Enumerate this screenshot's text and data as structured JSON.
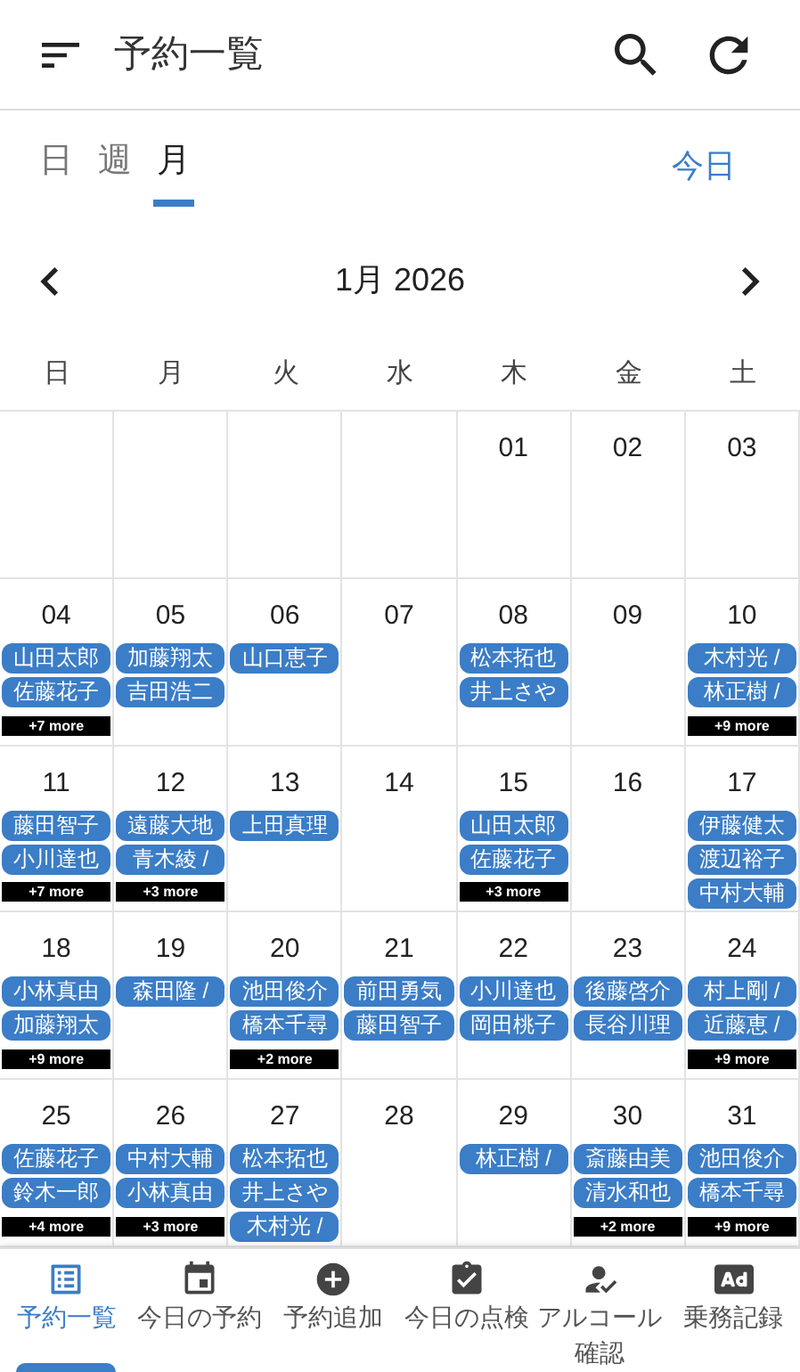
{
  "header": {
    "title": "予約一覧"
  },
  "view_tabs": [
    {
      "label": "日",
      "selected": false
    },
    {
      "label": "週",
      "selected": false
    },
    {
      "label": "月",
      "selected": true
    }
  ],
  "today_button": "今日",
  "month_label": "1月 2026",
  "weekdays": [
    "日",
    "月",
    "火",
    "水",
    "木",
    "金",
    "土"
  ],
  "cells": [
    {
      "kind": "empty"
    },
    {
      "kind": "empty"
    },
    {
      "kind": "empty"
    },
    {
      "kind": "empty"
    },
    {
      "kind": "day",
      "date": "01"
    },
    {
      "kind": "day",
      "date": "02"
    },
    {
      "kind": "day",
      "date": "03"
    },
    {
      "kind": "day",
      "date": "04",
      "events": [
        "山田太郎",
        "佐藤花子"
      ],
      "more": "+7 more"
    },
    {
      "kind": "day",
      "date": "05",
      "events": [
        "加藤翔太",
        "吉田浩二"
      ]
    },
    {
      "kind": "day",
      "date": "06",
      "events": [
        "山口恵子"
      ]
    },
    {
      "kind": "day",
      "date": "07"
    },
    {
      "kind": "day",
      "date": "08",
      "events": [
        "松本拓也",
        "井上さや"
      ]
    },
    {
      "kind": "day",
      "date": "09"
    },
    {
      "kind": "day",
      "date": "10",
      "events": [
        "木村光 /",
        "林正樹 /"
      ],
      "more": "+9 more"
    },
    {
      "kind": "day",
      "date": "11",
      "events": [
        "藤田智子",
        "小川達也"
      ],
      "more": "+7 more"
    },
    {
      "kind": "day",
      "date": "12",
      "events": [
        "遠藤大地",
        "青木綾 /"
      ],
      "more": "+3 more"
    },
    {
      "kind": "day",
      "date": "13",
      "events": [
        "上田真理"
      ]
    },
    {
      "kind": "day",
      "date": "14"
    },
    {
      "kind": "day",
      "date": "15",
      "events": [
        "山田太郎",
        "佐藤花子"
      ],
      "more": "+3 more"
    },
    {
      "kind": "day",
      "date": "16"
    },
    {
      "kind": "day",
      "date": "17",
      "events": [
        "伊藤健太",
        "渡辺裕子",
        "中村大輔"
      ]
    },
    {
      "kind": "day",
      "date": "18",
      "events": [
        "小林真由",
        "加藤翔太"
      ],
      "more": "+9 more"
    },
    {
      "kind": "day",
      "date": "19",
      "events": [
        "森田隆 /"
      ]
    },
    {
      "kind": "day",
      "date": "20",
      "events": [
        "池田俊介",
        "橋本千尋"
      ],
      "more": "+2 more"
    },
    {
      "kind": "day",
      "date": "21",
      "events": [
        "前田勇気",
        "藤田智子"
      ]
    },
    {
      "kind": "day",
      "date": "22",
      "events": [
        "小川達也",
        "岡田桃子"
      ]
    },
    {
      "kind": "day",
      "date": "23",
      "events": [
        "後藤啓介",
        "長谷川理"
      ]
    },
    {
      "kind": "day",
      "date": "24",
      "events": [
        "村上剛 /",
        "近藤恵 /"
      ],
      "more": "+9 more"
    },
    {
      "kind": "day",
      "date": "25",
      "events": [
        "佐藤花子",
        "鈴木一郎"
      ],
      "more": "+4 more"
    },
    {
      "kind": "day",
      "date": "26",
      "events": [
        "中村大輔",
        "小林真由"
      ],
      "more": "+3 more"
    },
    {
      "kind": "day",
      "date": "27",
      "events": [
        "松本拓也",
        "井上さや",
        "木村光 /"
      ]
    },
    {
      "kind": "day",
      "date": "28"
    },
    {
      "kind": "day",
      "date": "29",
      "events": [
        "林正樹 /"
      ]
    },
    {
      "kind": "day",
      "date": "30",
      "events": [
        "斎藤由美",
        "清水和也"
      ],
      "more": "+2 more"
    },
    {
      "kind": "day",
      "date": "31",
      "events": [
        "池田俊介",
        "橋本千尋"
      ],
      "more": "+9 more"
    }
  ],
  "bottom_nav": [
    {
      "kind": "list",
      "label": "予約一覧",
      "selected": true
    },
    {
      "kind": "calendar",
      "label": "今日の予約",
      "selected": false
    },
    {
      "kind": "add",
      "label": "予約追加",
      "selected": false
    },
    {
      "kind": "clipboard",
      "label": "今日の点検",
      "selected": false
    },
    {
      "kind": "person",
      "label": "アルコール確認",
      "selected": false
    },
    {
      "kind": "ad",
      "label": "乗務記録",
      "selected": false
    }
  ]
}
